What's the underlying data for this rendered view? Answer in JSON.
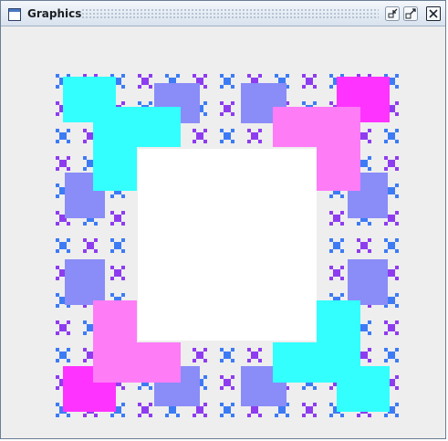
{
  "window": {
    "title": "Graphics"
  },
  "titlebar": {
    "buttons": [
      {
        "name": "iconify-button",
        "icon": "minimize-icon"
      },
      {
        "name": "maximize-button",
        "icon": "maximize-icon"
      },
      {
        "name": "close-button",
        "icon": "close-icon"
      }
    ]
  },
  "colors": {
    "frame_border": "#6b7f94",
    "content_background": "#eeeeee",
    "center_square": "#ffffff",
    "cyan": "#33ffff",
    "magenta": "#ff33ff",
    "blue": "#3d7bf5",
    "violet": "#8e3cf0",
    "lavender": "#8a8cf8",
    "pink": "#ff7cf7"
  }
}
